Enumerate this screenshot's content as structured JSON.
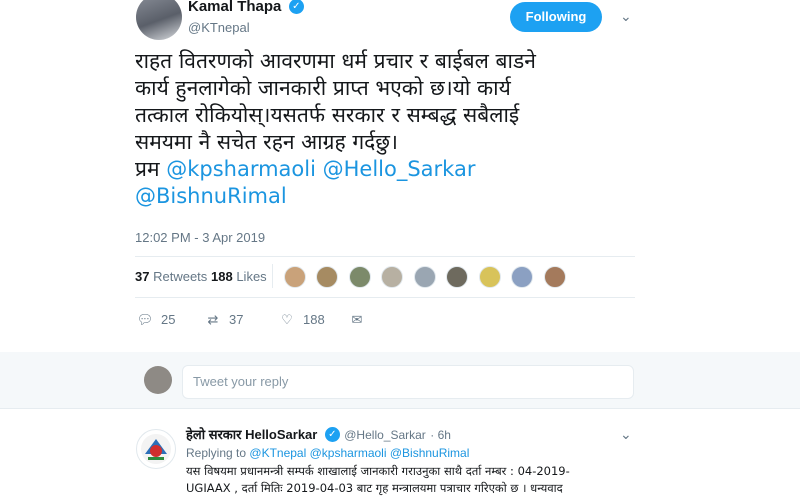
{
  "tweet": {
    "author_name": "Kamal Thapa",
    "author_handle": "@KTnepal",
    "follow_label": "Following",
    "text_lines": [
      "राहत वितरणको आवरणमा धर्म प्रचार र बाईबल बाडने",
      "कार्य हुनलागेको जानकारी प्राप्त भएको छ।यो कार्य",
      "तत्काल रोकियोस्।यसतर्फ सरकार र सम्बद्ध सबैलाई",
      "समयमा नै सचेत रहन आग्रह गर्दछु।"
    ],
    "prefix": "प्रम",
    "mentions": [
      "@kpsharmaoli",
      "@Hello_Sarkar",
      "@BishnuRimal"
    ],
    "timestamp": "12:02 PM - 3 Apr 2019",
    "retweets_count": "37",
    "retweets_label": "Retweets",
    "likes_count": "188",
    "likes_label": "Likes",
    "actions": {
      "replies": "25",
      "retweets": "37",
      "likes": "188"
    }
  },
  "reply_box": {
    "placeholder": "Tweet your reply"
  },
  "reply": {
    "author_name": "हेलो सरकार HelloSarkar",
    "author_handle": "@Hello_Sarkar",
    "age": "· 6h",
    "replying_prefix": "Replying to",
    "replying_to": [
      "@KTnepal",
      "@kpsharmaoli",
      "@BishnuRimal"
    ],
    "text_lines": [
      "यस विषयमा प्रधानमन्त्री सम्पर्क शाखालाई जानकारी गराउनुका साथै दर्ता नम्बर : 04-2019-",
      "UGIAAX , दर्ता मितिः 2019-04-03 बाट गृह मन्त्रालयमा पत्राचार गरिएको छ । धन्यवाद"
    ]
  },
  "colors": {
    "accent": "#1da1f2",
    "link": "#1b95e0",
    "muted": "#657786"
  }
}
